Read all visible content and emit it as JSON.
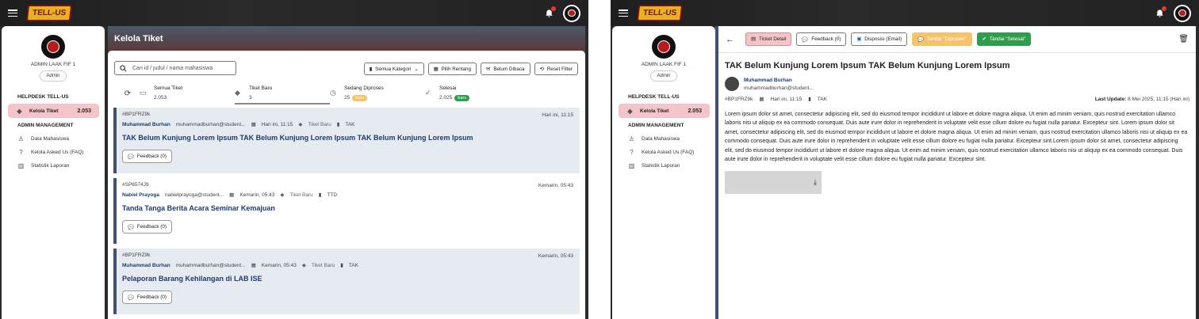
{
  "app": {
    "logo": "TELL-US"
  },
  "sidebar": {
    "admin_name": "ADMIN LAAK FIF 1",
    "admin_role": "Admin",
    "section_helpdesk": "HELPDESK TELL-US",
    "active_item": {
      "label": "Kelola Tiket",
      "count": "2.053"
    },
    "section_admin": "ADMIN MANAGEMENT",
    "items": [
      {
        "label": "Data Mahasiswa"
      },
      {
        "label": "Kelola Asked Us (FAQ)"
      },
      {
        "label": "Statistik Laporan"
      }
    ]
  },
  "list_page": {
    "title": "Kelola Tiket",
    "search_placeholder": "Cari id / judul / nama mahasiswa",
    "filters": [
      "Semua Kategori",
      "Pilih Rentang",
      "Belum Dibaca",
      "Reset Filter"
    ],
    "tabs": [
      {
        "label": "Semua Tiket",
        "value": "2.053",
        "badge": ""
      },
      {
        "label": "Tiket Baru",
        "value": "3",
        "badge": ""
      },
      {
        "label": "Sedang Diproses",
        "value": "25",
        "badge": "baru"
      },
      {
        "label": "Selesai",
        "value": "2.025",
        "badge": "baru"
      }
    ],
    "tickets": [
      {
        "id": "#BP1FRZ9k",
        "time": "Hari ini, 11:15",
        "name": "Muhammad Burhan",
        "email": "muhammadburhan@student...",
        "date": "Hari ini, 11:15",
        "status": "Tiket Baru",
        "category": "TAK",
        "title": "TAK Belum Kunjung Lorem Ipsum TAK Belum Kunjung Lorem Ipsum TAK Belum Kunjung Lorem Ipsum",
        "feedback": "Feedback  (0)"
      },
      {
        "id": "#SP6574J9",
        "time": "Kemarin, 05:43",
        "name": "Nabiel Prayoga",
        "email": "nabielprayoga@student...",
        "date": "Kemarin, 05:43",
        "status": "Tiket Baru",
        "category": "TTD",
        "title": "Tanda Tanga Berita Acara Seminar Kemajuan",
        "feedback": "Feedback  (0)"
      },
      {
        "id": "#BP1FRZ9k",
        "time": "Kemarin, 05:43",
        "name": "Muhammad Burhan",
        "email": "muhammadburhan@student...",
        "date": "Kemarin, 05:43",
        "status": "Tiket Baru",
        "category": "TAK",
        "title": "Pelaporan Barang Kehilangan di LAB ISE",
        "feedback": "Feedback  (0)"
      }
    ]
  },
  "detail_page": {
    "toolbar": {
      "detail": "Ticket Detail",
      "feedback": "Feedback  (0)",
      "disposisi": "Disposisi (Email)",
      "diproses": "Tandai \"Diproses\"",
      "selesai": "Tandai \"Selesai\""
    },
    "title": "TAK Belum Kunjung Lorem Ipsum TAK Belum Kunjung Lorem Ipsum",
    "author_name": "Muhammad Burhan",
    "author_email": "muhammadburhan@student...",
    "id": "#BP1FRZ9k",
    "date": "Hari ini, 11:15",
    "category": "TAK",
    "last_update_label": "Last Update:",
    "last_update": "8 Mei 2025, 11:15 (Hari ini)",
    "body": "Lorem ipsum dolor sit amet, consectetur adipiscing elit, sed do eiusmod tempor incididunt ut labore et dolore magna aliqua. Ut enim ad minim veniam, quis nostrud exercitation ullamco laboris nisi ut aliquip ex ea commodo consequat. Duis aute irure dolor in reprehenderit in voluptate velit esse cillum dolore eu fugiat nulla pariatur. Excepteur sint. Lorem ipsum dolor sit amet, consectetur adipiscing elit, sed do eiusmod tempor incididunt ut labore et dolore magna aliqua. Ut enim ad minim veniam, quis nostrud exercitation ullamco laboris nisi ut aliquip ex ea commodo consequat. Duis aute irure dolor in reprehenderit in voluptate velit esse cillum dolore eu fugiat nulla pariatur. Excepteur sint.Lorem ipsum dolor sit amet, consectetur adipiscing elit, sed do eiusmod tempor incididunt ut labore et dolore magna aliqua. Ut enim ad minim veniam, quis nostrud exercitation ullamco laboris nisi ut aliquip ex ea commodo consequat. Duis aute irure dolor in reprehenderit in voluptate velit esse cillum dolore eu fugiat nulla pariatur. Excepteur sint."
  },
  "colors": {
    "accent": "#3d5370",
    "active_nav": "#f4c5c8",
    "badge_orange": "#f6c36a",
    "badge_green": "#2e9e4e"
  }
}
